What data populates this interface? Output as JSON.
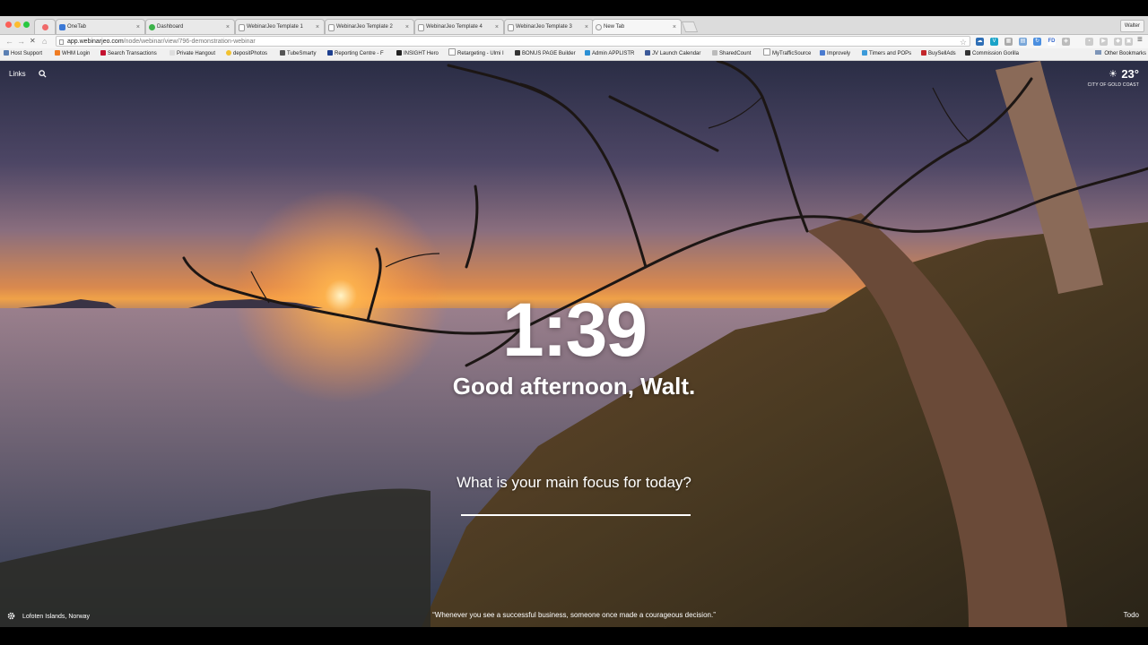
{
  "browser": {
    "tabs": [
      {
        "label": "",
        "active": false,
        "icon": "asana-icon"
      },
      {
        "label": "OneTab",
        "active": false,
        "icon": "onetab-icon"
      },
      {
        "label": "Dashboard",
        "active": false,
        "icon": "dashboard-icon"
      },
      {
        "label": "WebinarJeo Template 1",
        "active": false,
        "icon": "page-icon"
      },
      {
        "label": "WebinarJeo Template 2",
        "active": false,
        "icon": "page-icon"
      },
      {
        "label": "WebinarJeo Template 4",
        "active": false,
        "icon": "page-icon"
      },
      {
        "label": "WebinarJeo Template 3",
        "active": false,
        "icon": "page-icon"
      },
      {
        "label": "New Tab",
        "active": true,
        "icon": "loading-icon"
      }
    ],
    "user_label": "Walter",
    "url_host": "app.webinarjeo.com",
    "url_path": "/node/webinar/view/796-demonstration-webinar",
    "bookmarks": [
      "Host Support",
      "WHM Login",
      "Search Transactions",
      "Private Hangout",
      "depositPhotos",
      "TubeSmarty",
      "Reporting Centre - F",
      "INSIGHT Hero",
      "Retargeting - Ulmi I",
      "BONUS PAGE Builder",
      "Admin APPLISTR",
      "JV Launch Calendar",
      "SharedCount",
      "MyTrafficSource",
      "Improvely",
      "Timers and POPs",
      "BuySellAds",
      "Commission Gorilla"
    ],
    "other_bookmarks": "Other Bookmarks"
  },
  "page": {
    "links_label": "Links",
    "weather_temp": "23°",
    "weather_city": "CITY OF GOLD COAST",
    "clock": "1:39",
    "greeting": "Good afternoon, Walt.",
    "focus_question": "What is your main focus for today?",
    "focus_value": "",
    "location": "Lofoten Islands, Norway",
    "quote": "“Whenever you see a successful business, someone once made a courageous decision.”",
    "todo_label": "Todo"
  },
  "colors": {
    "accent": "#ffffff",
    "sunset": "#f0a248"
  }
}
